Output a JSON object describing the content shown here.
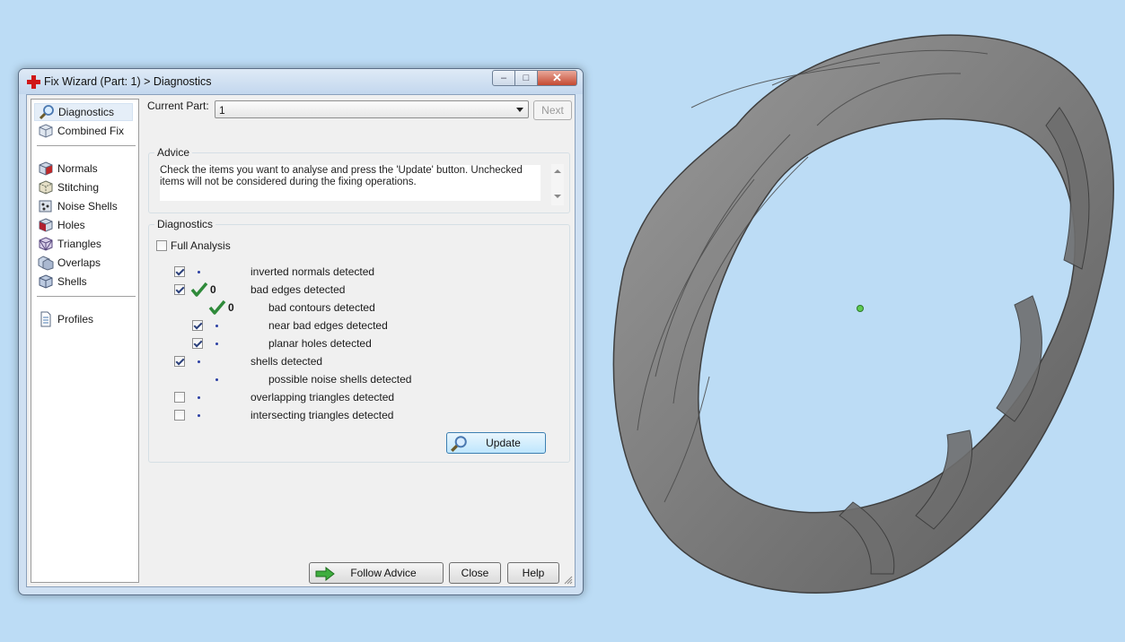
{
  "window": {
    "title": "Fix Wizard (Part: 1) > Diagnostics",
    "caption_buttons": {
      "minimize": "–",
      "maximize": "□",
      "close": "✕"
    }
  },
  "nav": {
    "items": [
      {
        "label": "Diagnostics",
        "icon": "magnifier-icon",
        "selected": true
      },
      {
        "label": "Combined Fix",
        "icon": "cube-icon"
      },
      {
        "label": "Normals",
        "icon": "normals-cube-icon"
      },
      {
        "label": "Stitching",
        "icon": "stitching-cube-icon"
      },
      {
        "label": "Noise Shells",
        "icon": "noise-shells-icon"
      },
      {
        "label": "Holes",
        "icon": "holes-cube-icon"
      },
      {
        "label": "Triangles",
        "icon": "triangles-cube-icon"
      },
      {
        "label": "Overlaps",
        "icon": "overlaps-icon"
      },
      {
        "label": "Shells",
        "icon": "shells-icon"
      },
      {
        "label": "Profiles",
        "icon": "document-icon"
      }
    ]
  },
  "current_part": {
    "label": "Current Part:",
    "value": "1"
  },
  "next_button": "Next",
  "advice": {
    "title": "Advice",
    "text": "Check the items you want to analyse and press the 'Update' button. Unchecked items will not be considered during the fixing operations."
  },
  "diagnostics": {
    "title": "Diagnostics",
    "full_analysis": {
      "label": "Full Analysis",
      "checked": false
    },
    "rows": [
      {
        "label": "inverted normals detected",
        "checked": true,
        "status": "dot"
      },
      {
        "label": "bad edges detected",
        "checked": true,
        "status": "ok",
        "count": "0"
      },
      {
        "label": "bad contours detected",
        "checked": null,
        "status": "ok",
        "count": "0"
      },
      {
        "label": "near bad edges detected",
        "checked": true,
        "status": "dot"
      },
      {
        "label": "planar holes detected",
        "checked": true,
        "status": "dot"
      },
      {
        "label": "shells detected",
        "checked": true,
        "status": "dot"
      },
      {
        "label": "possible noise shells detected",
        "checked": null,
        "status": "dot"
      },
      {
        "label": "overlapping triangles detected",
        "checked": false,
        "status": "dot"
      },
      {
        "label": "intersecting triangles detected",
        "checked": false,
        "status": "dot"
      }
    ],
    "update_button": "Update"
  },
  "footer": {
    "follow_advice": "Follow Advice",
    "close": "Close",
    "help": "Help"
  },
  "colors": {
    "background": "#bcdcf5",
    "model": "#8a8a8a",
    "check_green": "#2f8a3a",
    "title_red": "#d01818"
  }
}
